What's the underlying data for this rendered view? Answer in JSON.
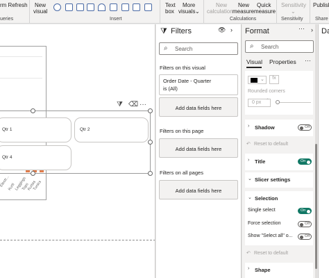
{
  "ribbon": {
    "refresh_label": "rm Refresh",
    "queries_label": "ueries",
    "new_visual_label_1": "New",
    "new_visual_label_2": "visual",
    "insert_label": "Insert",
    "text_box_1": "Text",
    "text_box_2": "box",
    "more_visuals_1": "More",
    "more_visuals_2": "visuals",
    "new_calc_1": "New",
    "new_calc_2": "calculation",
    "new_measure_1": "New",
    "new_measure_2": "measure",
    "quick_measure_1": "Quick",
    "quick_measure_2": "measure",
    "calculations_label": "Calculations",
    "sensitivity_label": "Sensitivity",
    "sensitivity_group": "Sensitivity",
    "publish_1": "Publish",
    "share_label": "Share"
  },
  "canvas": {
    "slicer_tiles": [
      "Qtr 1",
      "Qtr 2",
      "Qtr 4"
    ],
    "axis_labels": [
      "Electr...",
      "Kurti",
      "Leggings",
      "Tops",
      "Kurtas",
      "Tunics"
    ]
  },
  "filters": {
    "title": "Filters",
    "search_placeholder": "Search",
    "on_this_visual": "Filters on this visual",
    "filter_card_name": "Order Date - Quarter",
    "filter_card_value": "is (All)",
    "add_data_1": "Add data fields here",
    "on_this_page": "Filters on this page",
    "add_data_2": "Add data fields here",
    "on_all_pages": "Filters on all pages",
    "add_data_3": "Add data fields here"
  },
  "format": {
    "title": "Format",
    "search_placeholder": "Search",
    "tab_visual": "Visual",
    "tab_properties": "Properties",
    "rounded_corners": "Rounded corners",
    "corner_value": "0 px",
    "shadow": "Shadow",
    "shadow_toggle": "Off",
    "reset_1": "Reset to default",
    "title_section": "Title",
    "title_toggle": "On",
    "slicer_settings": "Slicer settings",
    "selection": "Selection",
    "single_select": "Single select",
    "single_select_toggle": "On",
    "force_selection": "Force selection",
    "force_selection_toggle": "Off",
    "show_select_all": "Show \"Select all\" o...",
    "show_select_all_toggle": "Off",
    "reset_2": "Reset to default",
    "shape": "Shape"
  },
  "data_pane": {
    "title": "Da"
  },
  "colors": {
    "accent_toggle": "#117865",
    "bar": "#e07c4b"
  }
}
